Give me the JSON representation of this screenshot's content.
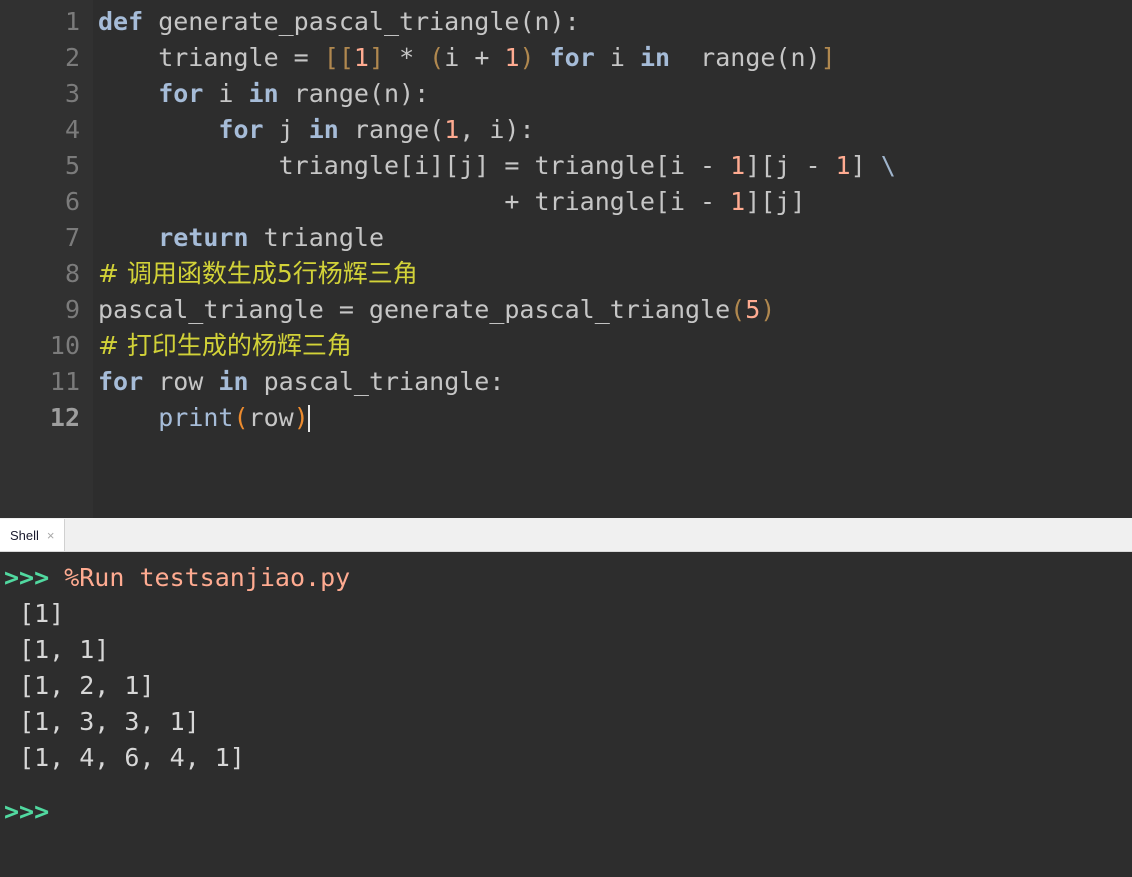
{
  "app": {
    "name": "Thonny",
    "theme": "dark",
    "colors": {
      "editor_bg": "#2d2d2d",
      "gutter_bg": "#313131",
      "gutter_fg": "#7b7b7b",
      "text_fg": "#c6c6c6",
      "keyword": "#a6bcd8",
      "number": "#ffab91",
      "comment": "#d2d238",
      "bracket": "#b0884f",
      "paren": "#ec8b2e",
      "prompt_green": "#51d9a0",
      "magic_salmon": "#ffab91",
      "tabbar_bg": "#f0f0f0",
      "tab_active_bg": "#ffffff",
      "tab_label_fg": "#1a1a2e"
    }
  },
  "editor": {
    "line_numbers": [
      "1",
      "2",
      "3",
      "4",
      "5",
      "6",
      "7",
      "8",
      "9",
      "10",
      "11",
      "12"
    ],
    "current_line": 12,
    "lines": [
      {
        "n": 1,
        "text": "def generate_pascal_triangle(n):"
      },
      {
        "n": 2,
        "text": "    triangle = [[1] * (i + 1) for i in range(n)]"
      },
      {
        "n": 3,
        "text": "    for i in range(n):"
      },
      {
        "n": 4,
        "text": "        for j in range(1, i):"
      },
      {
        "n": 5,
        "text": "            triangle[i][j] = triangle[i - 1][j - 1] \\"
      },
      {
        "n": 6,
        "text": "                           + triangle[i - 1][j]"
      },
      {
        "n": 7,
        "text": "    return triangle"
      },
      {
        "n": 8,
        "text": "# 调用函数生成5行杨辉三角"
      },
      {
        "n": 9,
        "text": "pascal_triangle = generate_pascal_triangle(5)"
      },
      {
        "n": 10,
        "text": "# 打印生成的杨辉三角"
      },
      {
        "n": 11,
        "text": "for row in pascal_triangle:"
      },
      {
        "n": 12,
        "text": "    print(row)"
      }
    ],
    "tokens": {
      "l1": {
        "kw": "def",
        "fn": " generate_pascal_triangle(n):"
      },
      "l2": {
        "a": "    triangle = ",
        "b1": "[[",
        "n1": "1",
        "b2": "]",
        "op": " * ",
        "p1": "(",
        "i": "i + ",
        "n2": "1",
        "p2": ")",
        "kw1": " for ",
        "i2": "i",
        "kw2": " in ",
        "r": " range(n)",
        "b3": "]"
      },
      "l3": {
        "ind": "    ",
        "kw1": "for",
        "v": " i ",
        "kw2": "in",
        "r": " range(n):"
      },
      "l4": {
        "ind": "        ",
        "kw1": "for",
        "v": " j ",
        "kw2": "in",
        "r1": " range(",
        "n1": "1",
        "r2": ", i):"
      },
      "l5": {
        "ind": "            ",
        "a": "triangle[i][j] = triangle[i - ",
        "n1": "1",
        "b": "][j - ",
        "n2": "1",
        "c": "] ",
        "cont": "\\"
      },
      "l6": {
        "ind": "                           ",
        "a": "+ triangle[i - ",
        "n1": "1",
        "b": "][j]"
      },
      "l7": {
        "ind": "    ",
        "kw": "return",
        "v": " triangle"
      },
      "l8": {
        "comment": "# 调用函数生成5行杨辉三角"
      },
      "l9": {
        "a": "pascal_triangle = generate_pascal_triangle",
        "p1": "(",
        "n1": "5",
        "p2": ")"
      },
      "l10": {
        "comment": "# 打印生成的杨辉三角"
      },
      "l11": {
        "kw1": "for",
        "v": " row ",
        "kw2": "in",
        "r": " pascal_triangle:"
      },
      "l12": {
        "ind": "    ",
        "fn": "print",
        "p1": "(",
        "v": "row",
        "p2": ")"
      }
    }
  },
  "tabbar": {
    "tabs": [
      {
        "label": "Shell",
        "close": "×",
        "active": true
      }
    ]
  },
  "shell": {
    "lines": [
      {
        "type": "command",
        "prompt": ">>>",
        "text": " %Run testsanjiao.py"
      },
      {
        "type": "output",
        "text": " [1]"
      },
      {
        "type": "output",
        "text": " [1, 1]"
      },
      {
        "type": "output",
        "text": " [1, 2, 1]"
      },
      {
        "type": "output",
        "text": " [1, 3, 3, 1]"
      },
      {
        "type": "output",
        "text": " [1, 4, 6, 4, 1]"
      },
      {
        "type": "prompt",
        "prompt": ">>>"
      }
    ]
  }
}
